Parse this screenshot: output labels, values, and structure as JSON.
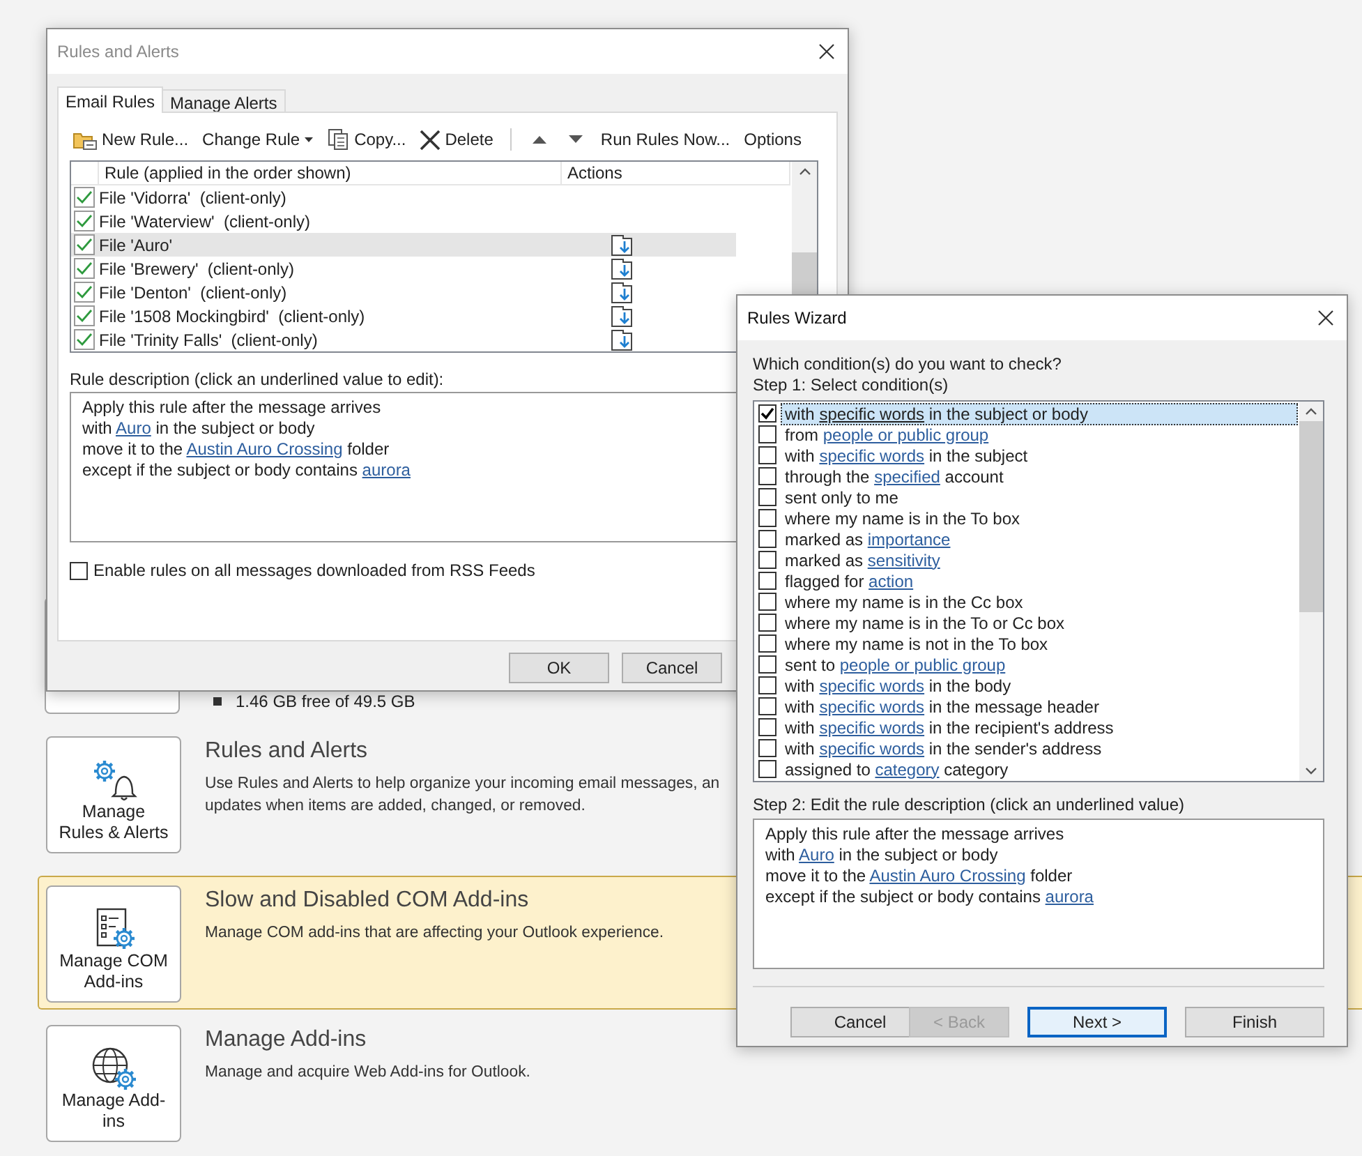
{
  "background": {
    "storage": {
      "text": "1.46 GB free of 49.5 GB"
    },
    "sections": [
      {
        "kind": "rules",
        "button": "Manage Rules & Alerts",
        "title": "Rules and Alerts",
        "lines": [
          "Use Rules and Alerts to help organize your incoming email messages, an",
          "updates when items are added, changed, or removed."
        ],
        "highlighted": false
      },
      {
        "kind": "com",
        "button": "Manage COM Add-ins",
        "title": "Slow and Disabled COM Add-ins",
        "lines": [
          "Manage COM add-ins that are affecting your Outlook experience."
        ],
        "highlighted": true
      },
      {
        "kind": "addins",
        "button": "Manage Add-ins",
        "title": "Manage Add-ins",
        "lines": [
          "Manage and acquire Web Add-ins for Outlook."
        ],
        "highlighted": false
      }
    ]
  },
  "rules_dialog": {
    "title": "Rules and Alerts",
    "active": false,
    "tabs": [
      {
        "label": "Email Rules",
        "selected": true
      },
      {
        "label": "Manage Alerts",
        "selected": false
      }
    ],
    "toolbar": [
      {
        "kind": "new",
        "label": "New Rule..."
      },
      {
        "kind": "dropdown",
        "label": "Change Rule"
      },
      {
        "kind": "copy",
        "label": "Copy..."
      },
      {
        "kind": "delete",
        "label": "Delete"
      },
      {
        "kind": "up"
      },
      {
        "kind": "down"
      },
      {
        "kind": "plain",
        "label": "Run Rules Now..."
      },
      {
        "kind": "plain",
        "label": "Options"
      }
    ],
    "columns": [
      "Rule (applied in the order shown)",
      "Actions"
    ],
    "rules": [
      {
        "name": "File 'Vidorra'  (client-only)",
        "checked": true,
        "selected": false,
        "action_icon": false
      },
      {
        "name": "File 'Waterview'  (client-only)",
        "checked": true,
        "selected": false,
        "action_icon": false
      },
      {
        "name": "File 'Auro'",
        "checked": true,
        "selected": true,
        "action_icon": true
      },
      {
        "name": "File 'Brewery'  (client-only)",
        "checked": true,
        "selected": false,
        "action_icon": true
      },
      {
        "name": "File 'Denton'  (client-only)",
        "checked": true,
        "selected": false,
        "action_icon": true
      },
      {
        "name": "File '1508 Mockingbird'  (client-only)",
        "checked": true,
        "selected": false,
        "action_icon": true
      },
      {
        "name": "File 'Trinity Falls'  (client-only)",
        "checked": true,
        "selected": false,
        "action_icon": true
      }
    ],
    "description_label": "Rule description (click an underlined value to edit):",
    "description": [
      [
        {
          "text": "Apply this rule after the message arrives"
        }
      ],
      [
        {
          "text": "with "
        },
        {
          "text": "Auro",
          "link": true
        },
        {
          "text": " in the subject or body"
        }
      ],
      [
        {
          "text": "move it to the "
        },
        {
          "text": "Austin Auro Crossing",
          "link": true
        },
        {
          "text": " folder"
        }
      ],
      [
        {
          "text": "except if the subject or body contains "
        },
        {
          "text": "aurora",
          "link": true
        }
      ]
    ],
    "rss": {
      "label": "Enable rules on all messages downloaded from RSS Feeds",
      "checked": false
    },
    "buttons": [
      {
        "label": "OK"
      },
      {
        "label": "Cancel"
      }
    ]
  },
  "wizard": {
    "title": "Rules Wizard",
    "active": true,
    "question": "Which condition(s) do you want to check?",
    "step1": "Step 1: Select condition(s)",
    "conditions": [
      {
        "checked": true,
        "selected": true,
        "parts": [
          {
            "text": "with "
          },
          {
            "text": "specific words",
            "link": true
          },
          {
            "text": " in the subject or body"
          }
        ]
      },
      {
        "checked": false,
        "selected": false,
        "parts": [
          {
            "text": "from "
          },
          {
            "text": "people or public group",
            "link": true
          }
        ]
      },
      {
        "checked": false,
        "selected": false,
        "parts": [
          {
            "text": "with "
          },
          {
            "text": "specific words",
            "link": true
          },
          {
            "text": " in the subject"
          }
        ]
      },
      {
        "checked": false,
        "selected": false,
        "parts": [
          {
            "text": "through the "
          },
          {
            "text": "specified",
            "link": true
          },
          {
            "text": " account"
          }
        ]
      },
      {
        "checked": false,
        "selected": false,
        "parts": [
          {
            "text": "sent only to me"
          }
        ]
      },
      {
        "checked": false,
        "selected": false,
        "parts": [
          {
            "text": "where my name is in the To box"
          }
        ]
      },
      {
        "checked": false,
        "selected": false,
        "parts": [
          {
            "text": "marked as "
          },
          {
            "text": "importance",
            "link": true
          }
        ]
      },
      {
        "checked": false,
        "selected": false,
        "parts": [
          {
            "text": "marked as "
          },
          {
            "text": "sensitivity",
            "link": true
          }
        ]
      },
      {
        "checked": false,
        "selected": false,
        "parts": [
          {
            "text": "flagged for "
          },
          {
            "text": "action",
            "link": true
          }
        ]
      },
      {
        "checked": false,
        "selected": false,
        "parts": [
          {
            "text": "where my name is in the Cc box"
          }
        ]
      },
      {
        "checked": false,
        "selected": false,
        "parts": [
          {
            "text": "where my name is in the To or Cc box"
          }
        ]
      },
      {
        "checked": false,
        "selected": false,
        "parts": [
          {
            "text": "where my name is not in the To box"
          }
        ]
      },
      {
        "checked": false,
        "selected": false,
        "parts": [
          {
            "text": "sent to "
          },
          {
            "text": "people or public group",
            "link": true
          }
        ]
      },
      {
        "checked": false,
        "selected": false,
        "parts": [
          {
            "text": "with "
          },
          {
            "text": "specific words",
            "link": true
          },
          {
            "text": " in the body"
          }
        ]
      },
      {
        "checked": false,
        "selected": false,
        "parts": [
          {
            "text": "with "
          },
          {
            "text": "specific words",
            "link": true
          },
          {
            "text": " in the message header"
          }
        ]
      },
      {
        "checked": false,
        "selected": false,
        "parts": [
          {
            "text": "with "
          },
          {
            "text": "specific words",
            "link": true
          },
          {
            "text": " in the recipient's address"
          }
        ]
      },
      {
        "checked": false,
        "selected": false,
        "parts": [
          {
            "text": "with "
          },
          {
            "text": "specific words",
            "link": true
          },
          {
            "text": " in the sender's address"
          }
        ]
      },
      {
        "checked": false,
        "selected": false,
        "parts": [
          {
            "text": "assigned to "
          },
          {
            "text": "category",
            "link": true
          },
          {
            "text": " category"
          }
        ]
      }
    ],
    "step2": "Step 2: Edit the rule description (click an underlined value)",
    "description": [
      [
        {
          "text": "Apply this rule after the message arrives"
        }
      ],
      [
        {
          "text": "with "
        },
        {
          "text": "Auro",
          "link": true
        },
        {
          "text": " in the subject or body"
        }
      ],
      [
        {
          "text": "move it to the "
        },
        {
          "text": "Austin Auro Crossing",
          "link": true
        },
        {
          "text": " folder"
        }
      ],
      [
        {
          "text": "except if the subject or body contains "
        },
        {
          "text": "aurora",
          "link": true
        }
      ]
    ],
    "buttons": [
      {
        "label": "Cancel",
        "disabled": false,
        "default": false
      },
      {
        "label": "< Back",
        "disabled": true,
        "default": false
      },
      {
        "label": "Next >",
        "disabled": false,
        "default": true
      },
      {
        "label": "Finish",
        "disabled": false,
        "default": false
      }
    ]
  }
}
